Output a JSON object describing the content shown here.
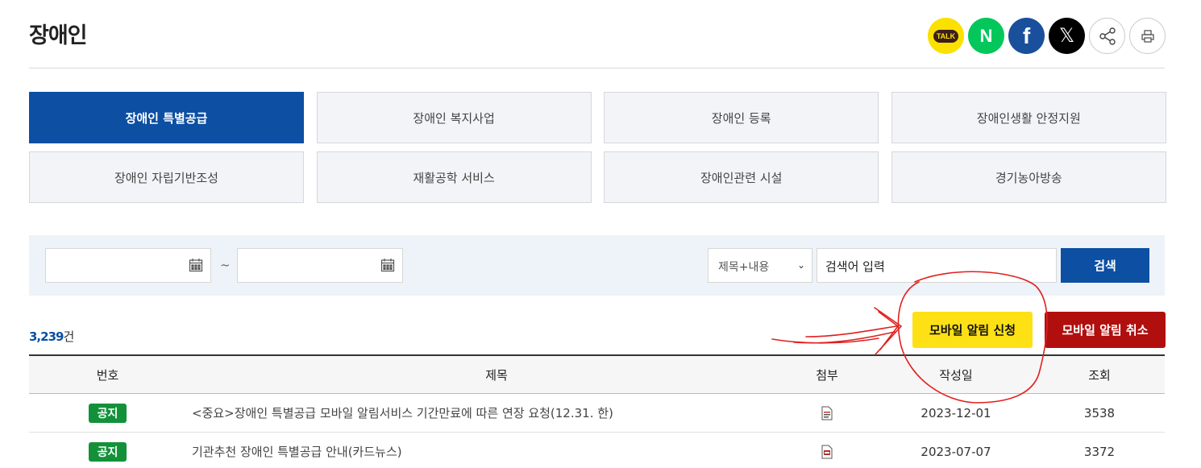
{
  "page": {
    "title": "장애인"
  },
  "share": [
    "kakaotalk-icon",
    "naver-icon",
    "facebook-icon",
    "x-icon",
    "share-icon",
    "print-icon"
  ],
  "share_labels": {
    "kakao": "TALK",
    "naver": "N",
    "facebook": "f",
    "x": "𝕏"
  },
  "tabs": [
    {
      "label": "장애인 특별공급",
      "active": true
    },
    {
      "label": "장애인 복지사업"
    },
    {
      "label": "장애인 등록"
    },
    {
      "label": "장애인생활 안정지원"
    },
    {
      "label": "장애인 자립기반조성"
    },
    {
      "label": "재활공학 서비스"
    },
    {
      "label": "장애인관련 시설"
    },
    {
      "label": "경기농아방송"
    }
  ],
  "search": {
    "date_from": "",
    "date_to": "",
    "tilde": "~",
    "field_select": "제목+내용",
    "keyword_placeholder": "검색어 입력",
    "button": "검색"
  },
  "count": {
    "number": "3,239",
    "unit": "건"
  },
  "mobile": {
    "apply": "모바일 알림 신청",
    "cancel": "모바일 알림 취소"
  },
  "table": {
    "headers": {
      "no": "번호",
      "title": "제목",
      "file": "첨부",
      "date": "작성일",
      "views": "조회"
    },
    "rows": [
      {
        "no": "공지",
        "title": "<중요>장애인 특별공급 모바일 알림서비스 기간만료에 따른 연장 요청(12.31. 한)",
        "file": "hwp-file-icon",
        "date": "2023-12-01",
        "views": "3538"
      },
      {
        "no": "공지",
        "title": "기관추천 장애인 특별공급 안내(카드뉴스)",
        "file": "pdf-file-icon",
        "date": "2023-07-07",
        "views": "3372"
      }
    ]
  },
  "colors": {
    "primary": "#0c4fa3",
    "yellow": "#fde115",
    "red": "#b10e0e",
    "notice_green": "#13913a",
    "annotation": "#e0201e"
  }
}
